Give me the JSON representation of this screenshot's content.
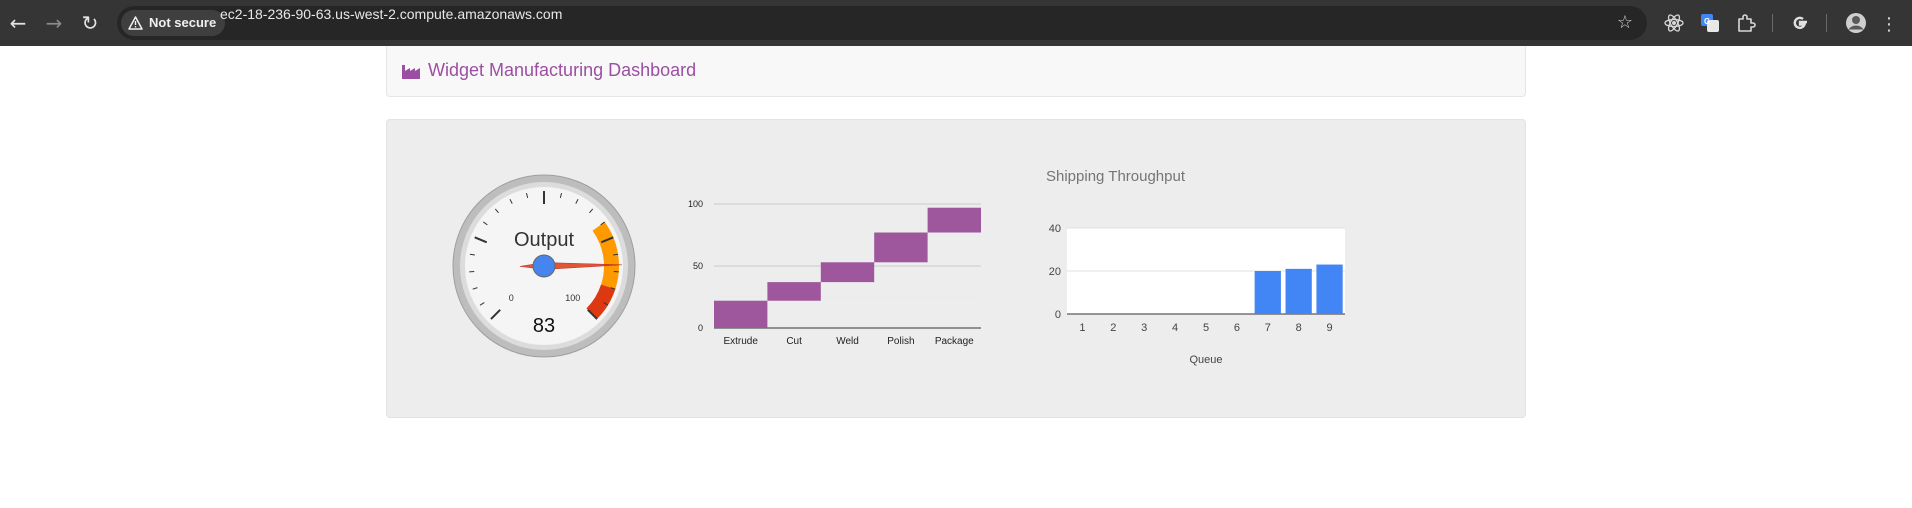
{
  "browser": {
    "security_label": "Not secure",
    "url": "ec2-18-236-90-63.us-west-2.compute.amazonaws.com"
  },
  "dashboard": {
    "title": "Widget Manufacturing Dashboard",
    "icon": "factory-icon",
    "accent": "#9b4fa3"
  },
  "chart_data": [
    {
      "type": "gauge",
      "label": "Output",
      "value": 83,
      "min": 0,
      "max": 100,
      "min_label": "0",
      "max_label": "100",
      "yellow_range": [
        70,
        90
      ],
      "red_range": [
        90,
        100
      ],
      "colors": {
        "yellow": "#ff9900",
        "red": "#dc3912",
        "needle": "#dc3912",
        "hub": "#4684ee"
      }
    },
    {
      "type": "bar",
      "subtype": "waterfall",
      "categories": [
        "Extrude",
        "Cut",
        "Weld",
        "Polish",
        "Package"
      ],
      "ranges": [
        [
          0,
          22
        ],
        [
          22,
          37
        ],
        [
          37,
          53
        ],
        [
          53,
          77
        ],
        [
          77,
          97
        ]
      ],
      "ylim": [
        0,
        100
      ],
      "yticks": [
        "0",
        "50",
        "100"
      ],
      "color": "#9e579d"
    },
    {
      "type": "bar",
      "title": "Shipping Throughput",
      "xlabel": "Queue",
      "categories": [
        "1",
        "2",
        "3",
        "4",
        "5",
        "6",
        "7",
        "8",
        "9"
      ],
      "values": [
        0,
        0,
        0,
        0,
        0,
        0,
        20,
        21,
        23
      ],
      "ylim": [
        0,
        40
      ],
      "yticks": [
        "0",
        "20",
        "40"
      ],
      "color": "#4285f4"
    }
  ]
}
